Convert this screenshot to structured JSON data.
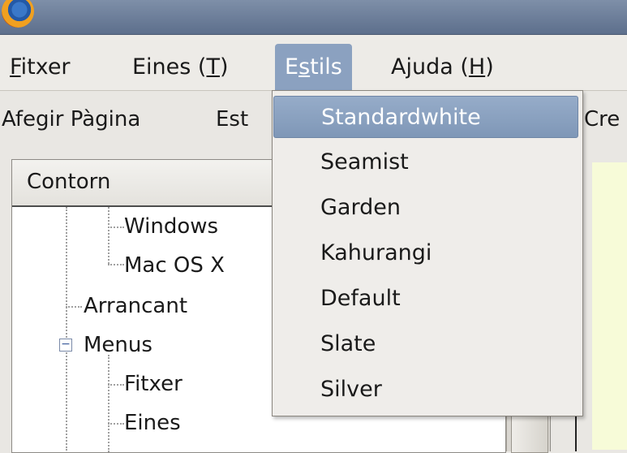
{
  "menubar": {
    "items": [
      {
        "label_pre": "",
        "mnemonic": "F",
        "label_post": "itxer"
      },
      {
        "label_pre": "Eines (",
        "mnemonic": "T",
        "label_post": ")"
      },
      {
        "label_pre": "E",
        "mnemonic": "s",
        "label_post": "tils"
      },
      {
        "label_pre": "Ajuda (",
        "mnemonic": "H",
        "label_post": ")"
      }
    ]
  },
  "toolbar": {
    "add_page": "Afegir Pàgina",
    "partial_left": "Est",
    "partial_right": "Cre"
  },
  "tree": {
    "header": "Contorn",
    "rows": [
      "Windows",
      "Mac OS X",
      "Arrancant",
      "Menus",
      "Fitxer",
      "Eines"
    ]
  },
  "dropdown": {
    "items": [
      "Standardwhite",
      "Seamist",
      "Garden",
      "Kahurangi",
      "Default",
      "Slate",
      "Silver"
    ],
    "selected": "Standardwhite"
  },
  "colors": {
    "titlebar": "#6b7d99",
    "menu_active": "#8ba1c0",
    "selection": "#889fbf",
    "content_bg": "#f7fbd8"
  }
}
